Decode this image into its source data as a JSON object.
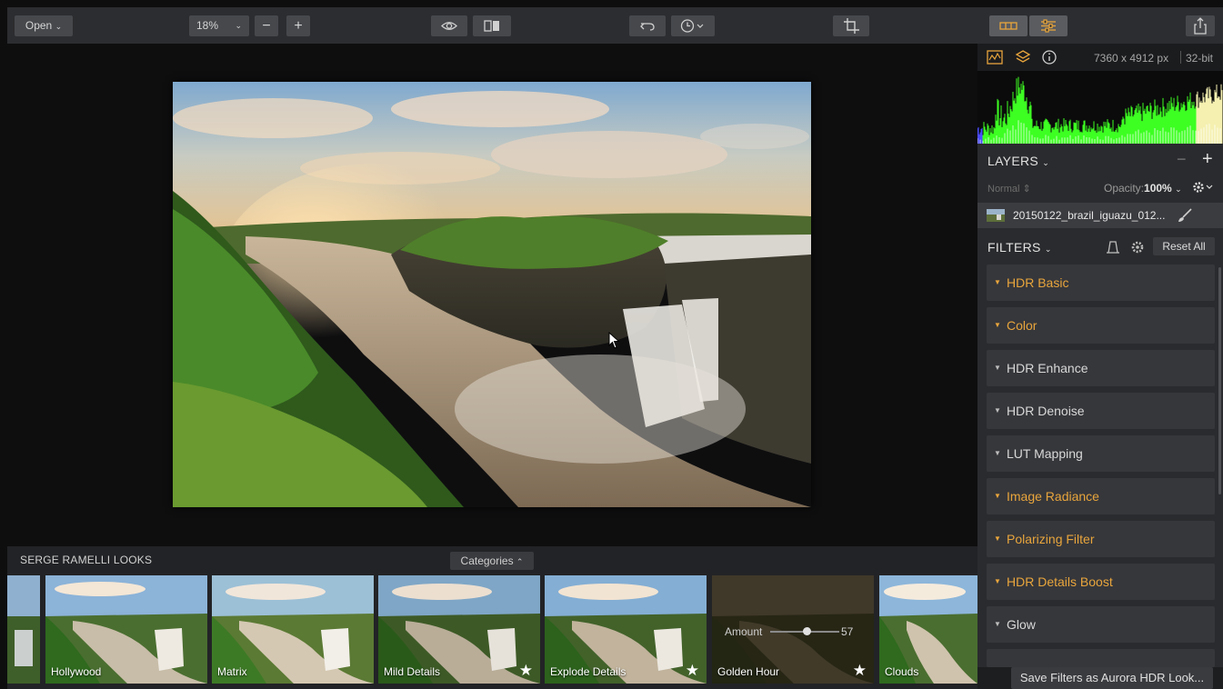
{
  "toolbar": {
    "open_label": "Open",
    "zoom_value": "18%",
    "zoom_out_label": "−",
    "zoom_in_label": "+"
  },
  "image_info": {
    "dimensions": "7360 x 4912 px",
    "bit_depth": "32-bit"
  },
  "layers": {
    "title": "LAYERS",
    "minus": "−",
    "plus": "+",
    "blend_mode": "Normal",
    "opacity_label": "Opacity:",
    "opacity_value": "100%",
    "layer_name": "20150122_brazil_iguazu_012..."
  },
  "filters": {
    "title": "FILTERS",
    "reset_label": "Reset All",
    "items": [
      {
        "label": "HDR Basic",
        "active": true
      },
      {
        "label": "Color",
        "active": true
      },
      {
        "label": "HDR Enhance",
        "active": false
      },
      {
        "label": "HDR Denoise",
        "active": false
      },
      {
        "label": "LUT Mapping",
        "active": false
      },
      {
        "label": "Image Radiance",
        "active": true
      },
      {
        "label": "Polarizing Filter",
        "active": true
      },
      {
        "label": "HDR Details Boost",
        "active": true
      },
      {
        "label": "Glow",
        "active": false
      }
    ],
    "save_label": "Save Filters as Aurora HDR Look..."
  },
  "looks": {
    "title": "SERGE RAMELLI LOOKS",
    "categories_label": "Categories",
    "items": [
      {
        "label": "Hollywood",
        "favorite": false
      },
      {
        "label": "Matrix",
        "favorite": false
      },
      {
        "label": "Mild Details",
        "favorite": true
      },
      {
        "label": "Explode Details",
        "favorite": true
      },
      {
        "label": "Golden Hour",
        "favorite": true,
        "selected": true
      },
      {
        "label": "Clouds",
        "favorite": false
      }
    ],
    "amount_label": "Amount",
    "amount_value": "57"
  },
  "colors": {
    "accent": "#e8a53c",
    "panel": "#2a2b2e",
    "toolbar": "#2c2d30"
  }
}
